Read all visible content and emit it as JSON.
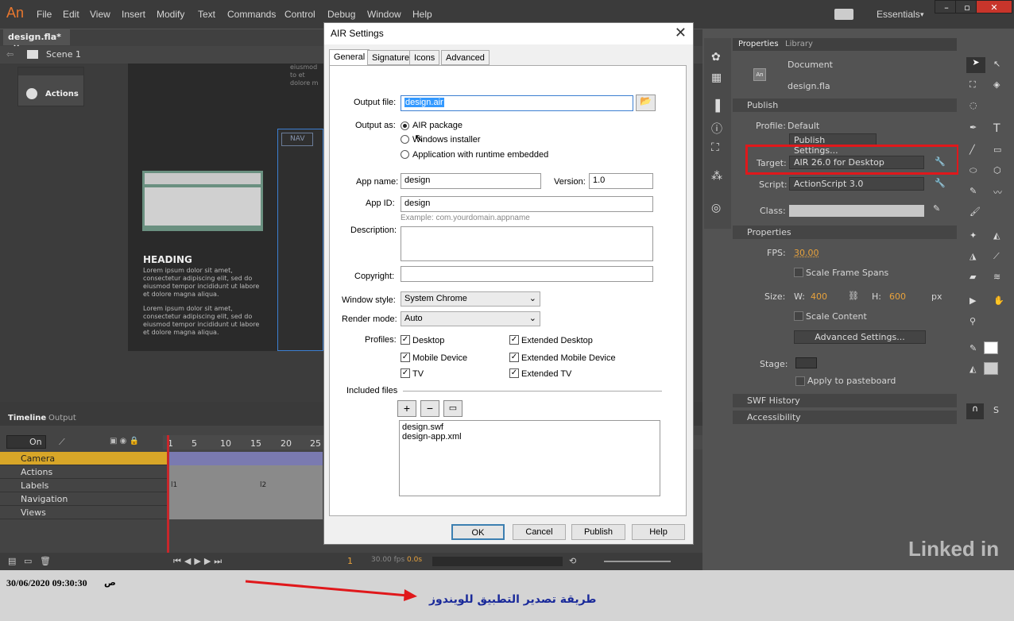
{
  "app": {
    "logo": "An"
  },
  "menu": [
    "File",
    "Edit",
    "View",
    "Insert",
    "Modify",
    "Text",
    "Commands",
    "Control",
    "Debug",
    "Window",
    "Help"
  ],
  "workspace": "Essentials",
  "document_tab": "design.fla*",
  "scene": "Scene 1",
  "actions_panel": "Actions",
  "artboard": {
    "nav_label": "NAV",
    "heading": "HEADING",
    "para1": "Lorem ipsum dolor sit amet, consectetur adipiscing elit, sed do eiusmod tempor incididunt ut labore et dolore magna aliqua.",
    "para2": "Lorem ipsum dolor sit amet, consectetur adipiscing elit, sed do eiusmod tempor incididunt ut labore et dolore magna aliqua.",
    "top_text": "eiusmod to et dolore m"
  },
  "timeline": {
    "tabs": [
      "Timeline",
      "Output"
    ],
    "on_label": "On",
    "frame_numbers": [
      "1",
      "5",
      "10",
      "15",
      "20",
      "25"
    ],
    "layers": [
      "Camera",
      "Actions",
      "Labels",
      "Navigation",
      "Views"
    ],
    "frame_label_1": "l1",
    "frame_label_2": "l2",
    "current_frame": "1",
    "fps": "30.00 fps",
    "time": "0.0s"
  },
  "dialog": {
    "title": "AIR Settings",
    "tabs": [
      "General",
      "Signature",
      "Icons",
      "Advanced"
    ],
    "output_file_label": "Output file:",
    "output_file": "design.air",
    "output_as_label": "Output as:",
    "output_options": [
      "AIR package",
      "Windows installer",
      "Application with runtime embedded"
    ],
    "app_name_label": "App name:",
    "app_name": "design",
    "version_label": "Version:",
    "version": "1.0",
    "app_id_label": "App ID:",
    "app_id": "design",
    "app_id_example": "Example: com.yourdomain.appname",
    "description_label": "Description:",
    "copyright_label": "Copyright:",
    "window_style_label": "Window style:",
    "window_style": "System Chrome",
    "render_mode_label": "Render mode:",
    "render_mode": "Auto",
    "profiles_label": "Profiles:",
    "profiles": [
      "Desktop",
      "Extended Desktop",
      "Mobile Device",
      "Extended Mobile Device",
      "TV",
      "Extended TV"
    ],
    "included_files_label": "Included files",
    "included_files": [
      "design.swf",
      "design-app.xml"
    ],
    "buttons": {
      "ok": "OK",
      "cancel": "Cancel",
      "publish": "Publish",
      "help": "Help"
    }
  },
  "properties": {
    "tabs": [
      "Properties",
      "Library"
    ],
    "doc_type": "Document",
    "doc_name": "design.fla",
    "publish_section": "Publish",
    "profile_label": "Profile:",
    "profile_value": "Default",
    "publish_settings": "Publish Settings...",
    "target_label": "Target:",
    "target_value": "AIR 26.0 for Desktop",
    "script_label": "Script:",
    "script_value": "ActionScript 3.0",
    "class_label": "Class:",
    "properties_section": "Properties",
    "fps_label": "FPS:",
    "fps_value": "30.00",
    "scale_frame_spans": "Scale Frame Spans",
    "size_label": "Size:",
    "w_label": "W:",
    "w_value": "400",
    "h_label": "H:",
    "h_value": "600",
    "px": "px",
    "scale_content": "Scale Content",
    "advanced_settings": "Advanced Settings...",
    "stage_label": "Stage:",
    "apply_pasteboard": "Apply to pasteboard",
    "swf_history": "SWF History",
    "accessibility": "Accessibility"
  },
  "watermark": "Linked in",
  "caption": {
    "timestamp": "30/06/2020 09:30:30",
    "timestamp_suffix": "ص",
    "arabic_note": "طريقة تصدير التطبيق  للويندوز"
  },
  "colors": {
    "highlight_box": "#e0181b",
    "arrow": "#e0181b",
    "caption_text": "#1a2a9a",
    "accent_orange": "#e8a23c",
    "camera_layer": "#d8a628"
  }
}
